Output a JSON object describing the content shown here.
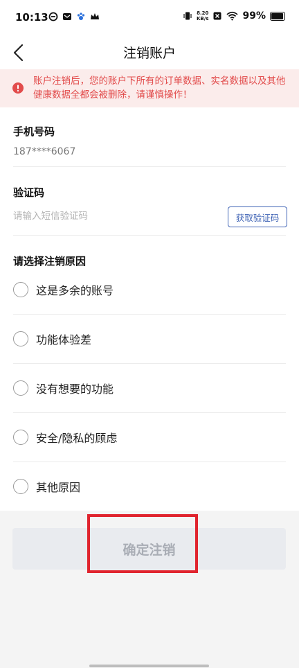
{
  "status_bar": {
    "time": "10:13",
    "net_speed_value": "8.20",
    "net_speed_unit": "KB/s",
    "battery": "99%"
  },
  "nav": {
    "title": "注销账户"
  },
  "warning": {
    "text": "账户注销后，您的账户下所有的订单数据、实名数据以及其他健康数据全都会被删除，请谨慎操作！",
    "color": "#e24b4b"
  },
  "phone": {
    "label": "手机号码",
    "value": "187****6067"
  },
  "code": {
    "label": "验证码",
    "placeholder": "请输入短信验证码",
    "button": "获取验证码"
  },
  "reasons": {
    "title": "请选择注销原因",
    "items": [
      {
        "label": "这是多余的账号"
      },
      {
        "label": "功能体验差"
      },
      {
        "label": "没有想要的功能"
      },
      {
        "label": "安全/隐私的顾虑"
      },
      {
        "label": "其他原因"
      }
    ]
  },
  "submit_label": "确定注销",
  "colors": {
    "accent": "#3f63b5",
    "highlight": "#e0242e",
    "disabled_button": "#e9ebef"
  }
}
